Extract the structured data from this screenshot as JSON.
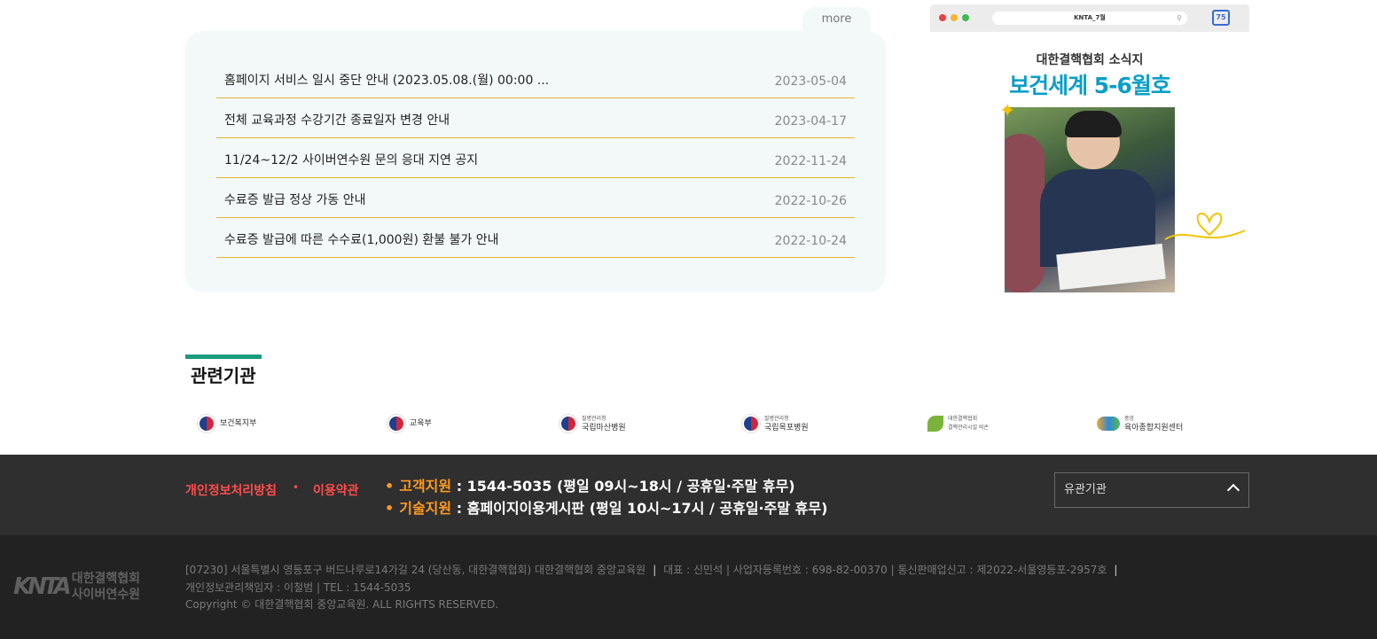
{
  "notice": {
    "more_label": "more",
    "items": [
      {
        "title": "홈페이지 서비스 일시 중단 안내 (2023.05.08.(월) 00:00 ...",
        "date": "2023-05-04"
      },
      {
        "title": "전체 교육과정 수강기간 종료일자 변경 안내",
        "date": "2023-04-17"
      },
      {
        "title": "11/24~12/2 사이버연수원 문의 응대 지연 공지",
        "date": "2022-11-24"
      },
      {
        "title": "수료증 발급 정상 가동 안내",
        "date": "2022-10-26"
      },
      {
        "title": "수료증 발급에 따른 수수료(1,000원) 환불 불가 안내",
        "date": "2022-10-24"
      }
    ]
  },
  "banner": {
    "url_text": "KNTA_7월",
    "subtitle": "대한결핵협회 소식지",
    "title": "보건세계 5-6월호"
  },
  "related": {
    "title": "관련기관",
    "orgs": [
      {
        "small": "",
        "name": "보건복지부"
      },
      {
        "small": "",
        "name": "교육부"
      },
      {
        "small": "질병관리청",
        "name": "국립마산병원"
      },
      {
        "small": "질병관리청",
        "name": "국립목포병원"
      },
      {
        "small": "대한결핵협회",
        "name": "결핵관리시설 비손"
      },
      {
        "small": "중앙",
        "name": "육아종합지원센터"
      }
    ]
  },
  "footer": {
    "privacy_label": "개인정보처리방침",
    "separator": "•",
    "terms_label": "이용약관",
    "support": [
      {
        "bullet": "•",
        "label": "고객지원",
        "text": " : 1544-5035 (평일 09시~18시 / 공휴일·주말 휴무)"
      },
      {
        "bullet": "•",
        "label": "기술지원",
        "text": " : 홈페이지이용게시판 (평일 10시~17시 / 공휴일·주말 휴무)"
      }
    ],
    "related_select": "유관기관",
    "logo_mark": "KNTA",
    "logo_line1": "대한결핵협회",
    "logo_line2": "사이버연수원",
    "address": "[07230] 서울특별시 영등포구 버드나루로14가길 24 (당산동, 대한결핵협회) 대한결핵협회 중앙교육원",
    "biz_info": "대표 : 신민석 | 사업자등록번호 : 698-82-00370 | 통신판매업신고 : 제2022-서울영등포-2957호",
    "privacy_officer": "개인정보관리책임자 : 이철범 | TEL : 1544-5035",
    "copyright": "Copyright © 대한결핵협회 중앙교육원. ALL RIGHTS RESERVED."
  },
  "colors": {
    "accent_green": "#1a9c7f",
    "notice_line": "#e4b23a",
    "policy_red": "#ff4d4d",
    "support_orange": "#ff9a1f",
    "magazine_blue": "#0a9fc8"
  }
}
